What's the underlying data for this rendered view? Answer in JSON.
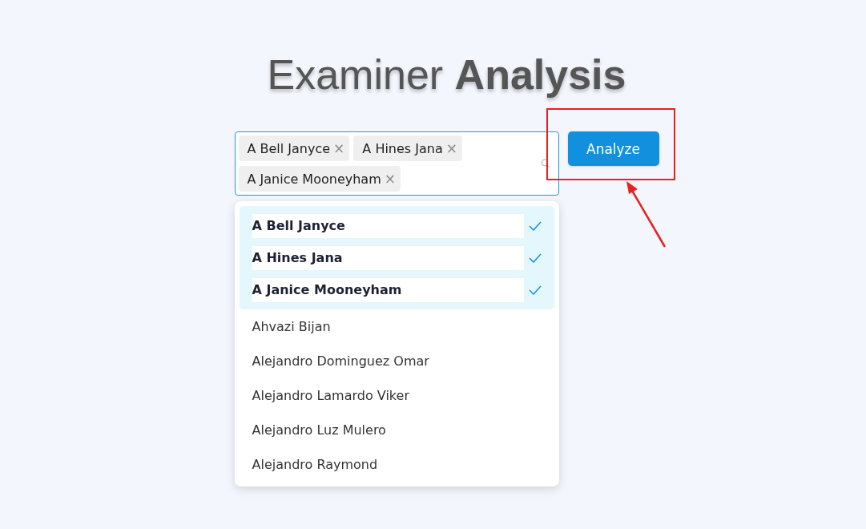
{
  "title": "Examiner **Analysis**",
  "selector": {
    "tags": [
      {
        "label": "A Bell Janyce",
        "remove": "×"
      },
      {
        "label": "A Hines Jana",
        "remove": "×"
      },
      {
        "label": "A Janice Mooneyham",
        "remove": "×"
      }
    ]
  },
  "button": {
    "label": "Analyze"
  },
  "annotation": {
    "kind": "highlight-box"
  },
  "options": [
    {
      "label": "A Bell Janyce",
      "selected": true
    },
    {
      "label": "A Hines Jana",
      "selected": true
    },
    {
      "label": "A Janice Mooneyham",
      "selected": true
    },
    {
      "label": "Ahvazi Bijan",
      "selected": false
    },
    {
      "label": "Alejandro Dominguez Omar",
      "selected": false
    },
    {
      "label": "Alejandro Lamardo Viker",
      "selected": false
    },
    {
      "label": "Alejandro Luz Mulero",
      "selected": false
    },
    {
      "label": "Alejandro Raymond",
      "selected": false
    }
  ]
}
